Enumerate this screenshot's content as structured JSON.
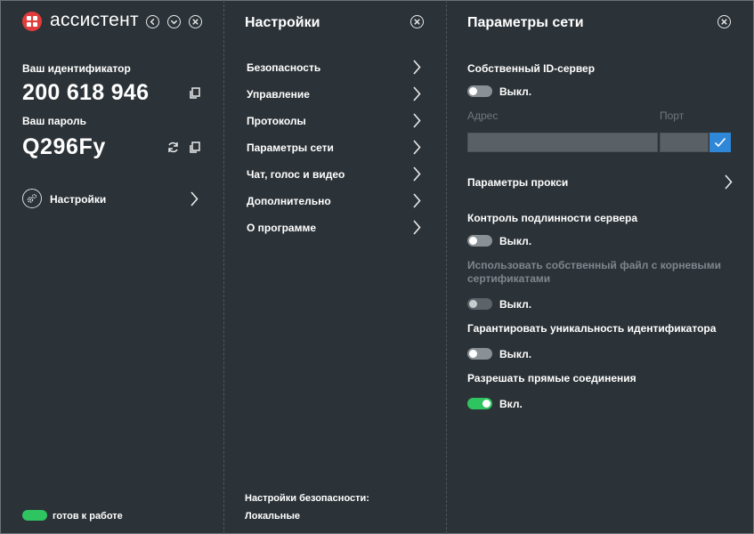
{
  "app": {
    "title": "ассистент"
  },
  "left": {
    "id_label": "Ваш идентификатор",
    "id_value": "200 618 946",
    "password_label": "Ваш пароль",
    "password_value": "Q296Fy",
    "settings_label": "Настройки",
    "status_text": "готов к работе",
    "status_color": "#2ec460"
  },
  "middle": {
    "title": "Настройки",
    "items": [
      {
        "label": "Безопасность"
      },
      {
        "label": "Управление"
      },
      {
        "label": "Протоколы"
      },
      {
        "label": "Параметры сети"
      },
      {
        "label": "Чат, голос и видео"
      },
      {
        "label": "Дополнительно"
      },
      {
        "label": "О программе"
      }
    ],
    "security_caption": "Настройки безопасности:",
    "security_value": "Локальные"
  },
  "right": {
    "title": "Параметры сети",
    "own_id_server": {
      "label": "Собственный ID-сервер",
      "state": "Выкл."
    },
    "address_label": "Адрес",
    "port_label": "Порт",
    "address_value": "",
    "port_value": "",
    "proxy_label": "Параметры прокси",
    "server_auth": {
      "label": "Контроль подлинности сервера",
      "state": "Выкл."
    },
    "own_root_certs": {
      "label": "Использовать собственный файл с корневыми сертификатами",
      "state": "Выкл."
    },
    "unique_id": {
      "label": "Гарантировать уникальность идентификатора",
      "state": "Выкл."
    },
    "direct_connections": {
      "label": "Разрешать прямые соединения",
      "state": "Вкл."
    }
  },
  "colors": {
    "accent_blue": "#2f87d8",
    "on_green": "#2ec460",
    "background": "#2c3338",
    "logo_red": "#e23b3b"
  }
}
